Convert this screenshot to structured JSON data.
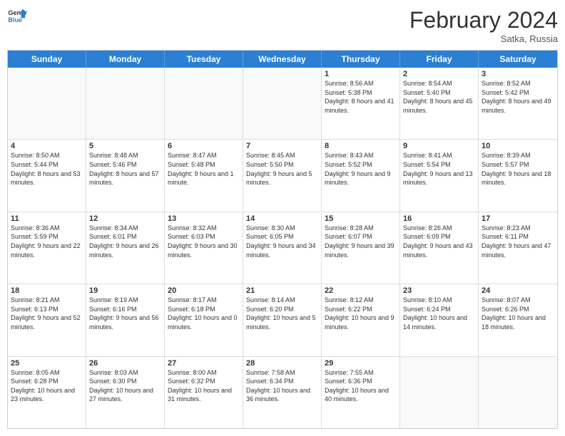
{
  "header": {
    "logo_general": "General",
    "logo_blue": "Blue",
    "month_title": "February 2024",
    "location": "Satka, Russia"
  },
  "days_of_week": [
    "Sunday",
    "Monday",
    "Tuesday",
    "Wednesday",
    "Thursday",
    "Friday",
    "Saturday"
  ],
  "rows": [
    [
      {
        "day": "",
        "empty": true
      },
      {
        "day": "",
        "empty": true
      },
      {
        "day": "",
        "empty": true
      },
      {
        "day": "",
        "empty": true
      },
      {
        "day": "1",
        "sunrise": "8:56 AM",
        "sunset": "5:38 PM",
        "daylight": "8 hours and 41 minutes."
      },
      {
        "day": "2",
        "sunrise": "8:54 AM",
        "sunset": "5:40 PM",
        "daylight": "8 hours and 45 minutes."
      },
      {
        "day": "3",
        "sunrise": "8:52 AM",
        "sunset": "5:42 PM",
        "daylight": "8 hours and 49 minutes."
      }
    ],
    [
      {
        "day": "4",
        "sunrise": "8:50 AM",
        "sunset": "5:44 PM",
        "daylight": "8 hours and 53 minutes."
      },
      {
        "day": "5",
        "sunrise": "8:48 AM",
        "sunset": "5:46 PM",
        "daylight": "8 hours and 57 minutes."
      },
      {
        "day": "6",
        "sunrise": "8:47 AM",
        "sunset": "5:48 PM",
        "daylight": "9 hours and 1 minute."
      },
      {
        "day": "7",
        "sunrise": "8:45 AM",
        "sunset": "5:50 PM",
        "daylight": "9 hours and 5 minutes."
      },
      {
        "day": "8",
        "sunrise": "8:43 AM",
        "sunset": "5:52 PM",
        "daylight": "9 hours and 9 minutes."
      },
      {
        "day": "9",
        "sunrise": "8:41 AM",
        "sunset": "5:54 PM",
        "daylight": "9 hours and 13 minutes."
      },
      {
        "day": "10",
        "sunrise": "8:39 AM",
        "sunset": "5:57 PM",
        "daylight": "9 hours and 18 minutes."
      }
    ],
    [
      {
        "day": "11",
        "sunrise": "8:36 AM",
        "sunset": "5:59 PM",
        "daylight": "9 hours and 22 minutes."
      },
      {
        "day": "12",
        "sunrise": "8:34 AM",
        "sunset": "6:01 PM",
        "daylight": "9 hours and 26 minutes."
      },
      {
        "day": "13",
        "sunrise": "8:32 AM",
        "sunset": "6:03 PM",
        "daylight": "9 hours and 30 minutes."
      },
      {
        "day": "14",
        "sunrise": "8:30 AM",
        "sunset": "6:05 PM",
        "daylight": "9 hours and 34 minutes."
      },
      {
        "day": "15",
        "sunrise": "8:28 AM",
        "sunset": "6:07 PM",
        "daylight": "9 hours and 39 minutes."
      },
      {
        "day": "16",
        "sunrise": "8:26 AM",
        "sunset": "6:09 PM",
        "daylight": "9 hours and 43 minutes."
      },
      {
        "day": "17",
        "sunrise": "8:23 AM",
        "sunset": "6:11 PM",
        "daylight": "9 hours and 47 minutes."
      }
    ],
    [
      {
        "day": "18",
        "sunrise": "8:21 AM",
        "sunset": "6:13 PM",
        "daylight": "9 hours and 52 minutes."
      },
      {
        "day": "19",
        "sunrise": "8:19 AM",
        "sunset": "6:16 PM",
        "daylight": "9 hours and 56 minutes."
      },
      {
        "day": "20",
        "sunrise": "8:17 AM",
        "sunset": "6:18 PM",
        "daylight": "10 hours and 0 minutes."
      },
      {
        "day": "21",
        "sunrise": "8:14 AM",
        "sunset": "6:20 PM",
        "daylight": "10 hours and 5 minutes."
      },
      {
        "day": "22",
        "sunrise": "8:12 AM",
        "sunset": "6:22 PM",
        "daylight": "10 hours and 9 minutes."
      },
      {
        "day": "23",
        "sunrise": "8:10 AM",
        "sunset": "6:24 PM",
        "daylight": "10 hours and 14 minutes."
      },
      {
        "day": "24",
        "sunrise": "8:07 AM",
        "sunset": "6:26 PM",
        "daylight": "10 hours and 18 minutes."
      }
    ],
    [
      {
        "day": "25",
        "sunrise": "8:05 AM",
        "sunset": "6:28 PM",
        "daylight": "10 hours and 23 minutes."
      },
      {
        "day": "26",
        "sunrise": "8:03 AM",
        "sunset": "6:30 PM",
        "daylight": "10 hours and 27 minutes."
      },
      {
        "day": "27",
        "sunrise": "8:00 AM",
        "sunset": "6:32 PM",
        "daylight": "10 hours and 31 minutes."
      },
      {
        "day": "28",
        "sunrise": "7:58 AM",
        "sunset": "6:34 PM",
        "daylight": "10 hours and 36 minutes."
      },
      {
        "day": "29",
        "sunrise": "7:55 AM",
        "sunset": "6:36 PM",
        "daylight": "10 hours and 40 minutes."
      },
      {
        "day": "",
        "empty": true
      },
      {
        "day": "",
        "empty": true
      }
    ]
  ]
}
